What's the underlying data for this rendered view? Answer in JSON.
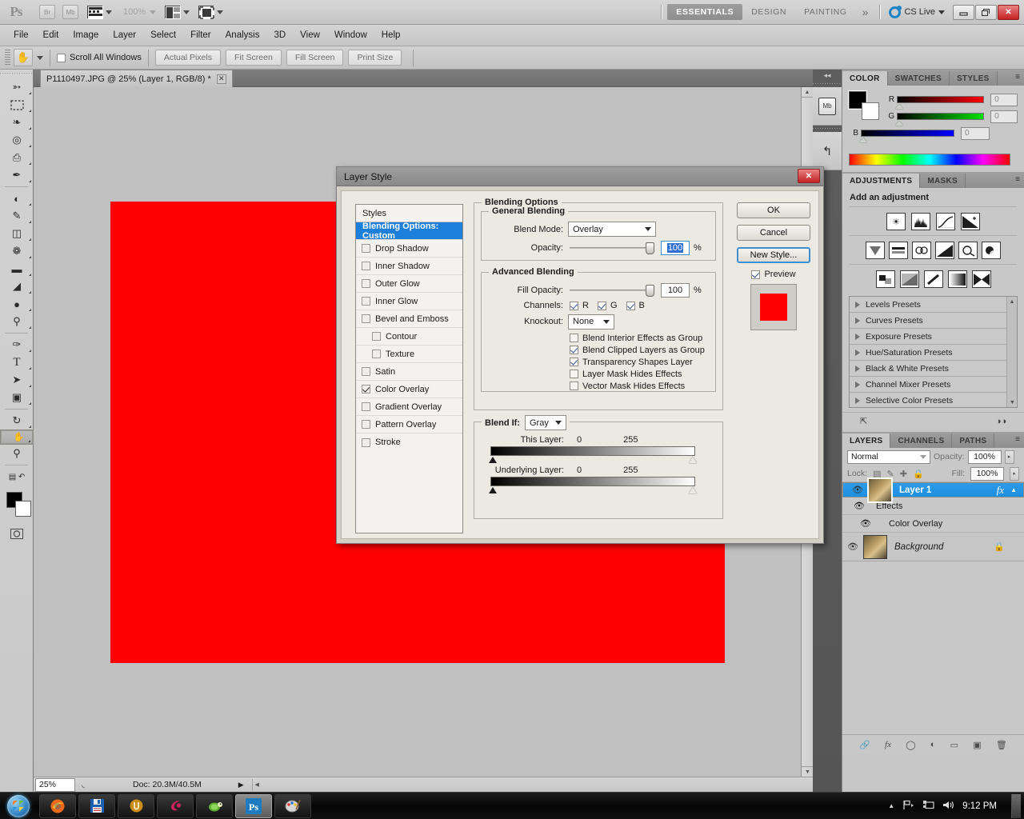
{
  "app": {
    "name": "Adobe Photoshop",
    "logo": "Ps",
    "zoom_level": "100%",
    "bridge_label": "Br",
    "minibridge_label": "Mb"
  },
  "workspace": {
    "tabs": [
      "ESSENTIALS",
      "DESIGN",
      "PAINTING"
    ],
    "active": "ESSENTIALS",
    "more": "»",
    "cslive": "CS Live",
    "window_controls": {
      "minimize": "—",
      "restore": "❐",
      "close": "✕"
    }
  },
  "menubar": {
    "items": [
      "File",
      "Edit",
      "Image",
      "Layer",
      "Select",
      "Filter",
      "Analysis",
      "3D",
      "View",
      "Window",
      "Help"
    ]
  },
  "optionsbar": {
    "tool": "hand-tool",
    "scroll_all_windows": "Scroll All Windows",
    "scroll_all_windows_checked": false,
    "buttons": [
      "Actual Pixels",
      "Fit Screen",
      "Fill Screen",
      "Print Size"
    ]
  },
  "toolbar": {
    "tools": [
      {
        "name": "move-tool",
        "glyph": "↖",
        "selected": false
      },
      {
        "name": "rectangular-marquee-tool",
        "glyph": "⬚",
        "selected": false
      },
      {
        "name": "lasso-tool",
        "glyph": "❀",
        "selected": false
      },
      {
        "name": "quick-selection-tool",
        "glyph": "◌",
        "selected": false
      },
      {
        "name": "crop-tool",
        "glyph": "⌗",
        "selected": false
      },
      {
        "name": "eyedropper-tool",
        "glyph": "✒",
        "selected": false
      },
      {
        "name": "spot-healing-brush-tool",
        "glyph": "⊕",
        "selected": false
      },
      {
        "name": "brush-tool",
        "glyph": "✎",
        "selected": false
      },
      {
        "name": "clone-stamp-tool",
        "glyph": "⚓",
        "selected": false
      },
      {
        "name": "history-brush-tool",
        "glyph": "❁",
        "selected": false
      },
      {
        "name": "eraser-tool",
        "glyph": "▰",
        "selected": false
      },
      {
        "name": "gradient-tool",
        "glyph": "◢",
        "selected": false
      },
      {
        "name": "blur-tool",
        "glyph": "●",
        "selected": false
      },
      {
        "name": "dodge-tool",
        "glyph": "⚲",
        "selected": false
      },
      {
        "name": "pen-tool",
        "glyph": "✑",
        "selected": false
      },
      {
        "name": "horizontal-type-tool",
        "glyph": "T",
        "selected": false
      },
      {
        "name": "path-selection-tool",
        "glyph": "➤",
        "selected": false
      },
      {
        "name": "rectangle-tool",
        "glyph": "▣",
        "selected": false
      },
      {
        "name": "3d-rotate-tool",
        "glyph": "↻",
        "selected": false
      },
      {
        "name": "hand-tool",
        "glyph": "✋",
        "selected": true
      },
      {
        "name": "zoom-tool",
        "glyph": "⚲",
        "selected": false
      }
    ],
    "foreground_color": "#000000",
    "background_color": "#ffffff",
    "quick_mask": "quick-mask-mode"
  },
  "document": {
    "tab_title": "P1110497.JPG @ 25% (Layer 1, RGB/8) *",
    "close_glyph": "✕",
    "canvas_fill": "#fe0000"
  },
  "statusbar": {
    "zoom": "25%",
    "doc_info": "Doc: 20.3M/40.5M",
    "arrow": "▶"
  },
  "dialog": {
    "title": "Layer Style",
    "close_glyph": "✕",
    "styles_header": "Styles",
    "styles": [
      {
        "label": "Blending Options: Custom",
        "checked": null,
        "active": true,
        "indent": false
      },
      {
        "label": "Drop Shadow",
        "checked": false,
        "active": false,
        "indent": false
      },
      {
        "label": "Inner Shadow",
        "checked": false,
        "active": false,
        "indent": false
      },
      {
        "label": "Outer Glow",
        "checked": false,
        "active": false,
        "indent": false
      },
      {
        "label": "Inner Glow",
        "checked": false,
        "active": false,
        "indent": false
      },
      {
        "label": "Bevel and Emboss",
        "checked": false,
        "active": false,
        "indent": false
      },
      {
        "label": "Contour",
        "checked": false,
        "active": false,
        "indent": true
      },
      {
        "label": "Texture",
        "checked": false,
        "active": false,
        "indent": true
      },
      {
        "label": "Satin",
        "checked": false,
        "active": false,
        "indent": false
      },
      {
        "label": "Color Overlay",
        "checked": true,
        "active": false,
        "indent": false
      },
      {
        "label": "Gradient Overlay",
        "checked": false,
        "active": false,
        "indent": false
      },
      {
        "label": "Pattern Overlay",
        "checked": false,
        "active": false,
        "indent": false
      },
      {
        "label": "Stroke",
        "checked": false,
        "active": false,
        "indent": false
      }
    ],
    "blending_options_legend": "Blending Options",
    "general_blending": {
      "legend": "General Blending",
      "blend_mode_label": "Blend Mode:",
      "blend_mode_value": "Overlay",
      "opacity_label": "Opacity:",
      "opacity_value": "100",
      "percent": "%"
    },
    "advanced_blending": {
      "legend": "Advanced Blending",
      "fill_opacity_label": "Fill Opacity:",
      "fill_opacity_value": "100",
      "percent": "%",
      "channels_label": "Channels:",
      "channels": [
        {
          "label": "R",
          "checked": true
        },
        {
          "label": "G",
          "checked": true
        },
        {
          "label": "B",
          "checked": true
        }
      ],
      "knockout_label": "Knockout:",
      "knockout_value": "None",
      "checkboxes": [
        {
          "label": "Blend Interior Effects as Group",
          "checked": false
        },
        {
          "label": "Blend Clipped Layers as Group",
          "checked": true
        },
        {
          "label": "Transparency Shapes Layer",
          "checked": true
        },
        {
          "label": "Layer Mask Hides Effects",
          "checked": false
        },
        {
          "label": "Vector Mask Hides Effects",
          "checked": false
        }
      ]
    },
    "blend_if": {
      "label": "Blend If:",
      "channel": "Gray",
      "this_layer_label": "This Layer:",
      "this_layer_min": "0",
      "this_layer_max": "255",
      "underlying_layer_label": "Underlying Layer:",
      "underlying_layer_min": "0",
      "underlying_layer_max": "255"
    },
    "buttons": {
      "ok": "OK",
      "cancel": "Cancel",
      "new_style": "New Style...",
      "preview_label": "Preview",
      "preview_checked": true,
      "preview_color": "#fe0000"
    }
  },
  "dock": {
    "collapse_glyph": "◂◂",
    "items": [
      {
        "name": "mini-bridge-icon",
        "label": "Mb"
      },
      {
        "name": "history-icon",
        "label": "↰"
      }
    ]
  },
  "color_panel": {
    "tabs": [
      "COLOR",
      "SWATCHES",
      "STYLES"
    ],
    "active": "COLOR",
    "menu_glyph": "≡",
    "sliders": [
      {
        "label": "R",
        "value": "0",
        "color": "#ff0000"
      },
      {
        "label": "G",
        "value": "0",
        "color": "#00e000"
      },
      {
        "label": "B",
        "value": "0",
        "color": "#0000ff"
      }
    ],
    "foreground": "#000000",
    "background": "#ffffff"
  },
  "adjustments_panel": {
    "tabs": [
      "ADJUSTMENTS",
      "MASKS"
    ],
    "active": "ADJUSTMENTS",
    "menu_glyph": "≡",
    "title": "Add an adjustment",
    "row1": [
      "brightness-contrast-icon",
      "levels-icon",
      "curves-icon",
      "exposure-icon"
    ],
    "row2": [
      "vibrance-icon",
      "hue-saturation-icon",
      "color-balance-icon",
      "black-white-icon",
      "photo-filter-icon",
      "channel-mixer-icon"
    ],
    "row3": [
      "invert-icon",
      "posterize-icon",
      "threshold-icon",
      "gradient-map-icon",
      "selective-color-icon"
    ],
    "presets": [
      "Levels Presets",
      "Curves Presets",
      "Exposure Presets",
      "Hue/Saturation Presets",
      "Black & White Presets",
      "Channel Mixer Presets",
      "Selective Color Presets"
    ],
    "footer_left": "return-to-adjustment-list-icon",
    "footer_right": "clip-to-layer-icon"
  },
  "layers_panel": {
    "tabs": [
      "LAYERS",
      "CHANNELS",
      "PATHS"
    ],
    "active": "LAYERS",
    "menu_glyph": "≡",
    "blend_mode": "Normal",
    "opacity_label": "Opacity:",
    "opacity_value": "100%",
    "lock_label": "Lock:",
    "lock_icons": [
      "lock-transparent-pixels-icon",
      "lock-image-pixels-icon",
      "lock-position-icon",
      "lock-all-icon"
    ],
    "fill_label": "Fill:",
    "fill_value": "100%",
    "layers": [
      {
        "name": "Layer 1",
        "selected": true,
        "has_fx": true,
        "visible": true,
        "locked": false
      },
      {
        "name": "Effects",
        "sub": true,
        "visible": true
      },
      {
        "name": "Color Overlay",
        "sub": true,
        "sub2": true,
        "visible": true
      },
      {
        "name": "Background",
        "selected": false,
        "visible": true,
        "locked": true
      }
    ],
    "fx_glyph": "fx",
    "footer_icons": [
      "link-layers-icon",
      "add-layer-style-icon",
      "add-layer-mask-icon",
      "new-fill-adjustment-icon",
      "new-group-icon",
      "new-layer-icon",
      "delete-layer-icon"
    ]
  },
  "taskbar": {
    "start": "start-orb",
    "items": [
      {
        "name": "firefox-taskbar-icon",
        "glyph": "🦊"
      },
      {
        "name": "save-taskbar-icon",
        "glyph": "💾"
      },
      {
        "name": "utorrent-taskbar-icon",
        "glyph": "◉"
      },
      {
        "name": "clementine-taskbar-icon",
        "glyph": "✿"
      },
      {
        "name": "turtle-taskbar-icon",
        "glyph": "🐢"
      },
      {
        "name": "photoshop-taskbar-icon",
        "glyph": "Ps",
        "active": true
      },
      {
        "name": "paint-taskbar-icon",
        "glyph": "🎨"
      }
    ],
    "tray": {
      "show_hidden": "▲",
      "network": "⚑",
      "display": "⎕",
      "volume": "🔊",
      "clock": "9:12 PM"
    }
  }
}
